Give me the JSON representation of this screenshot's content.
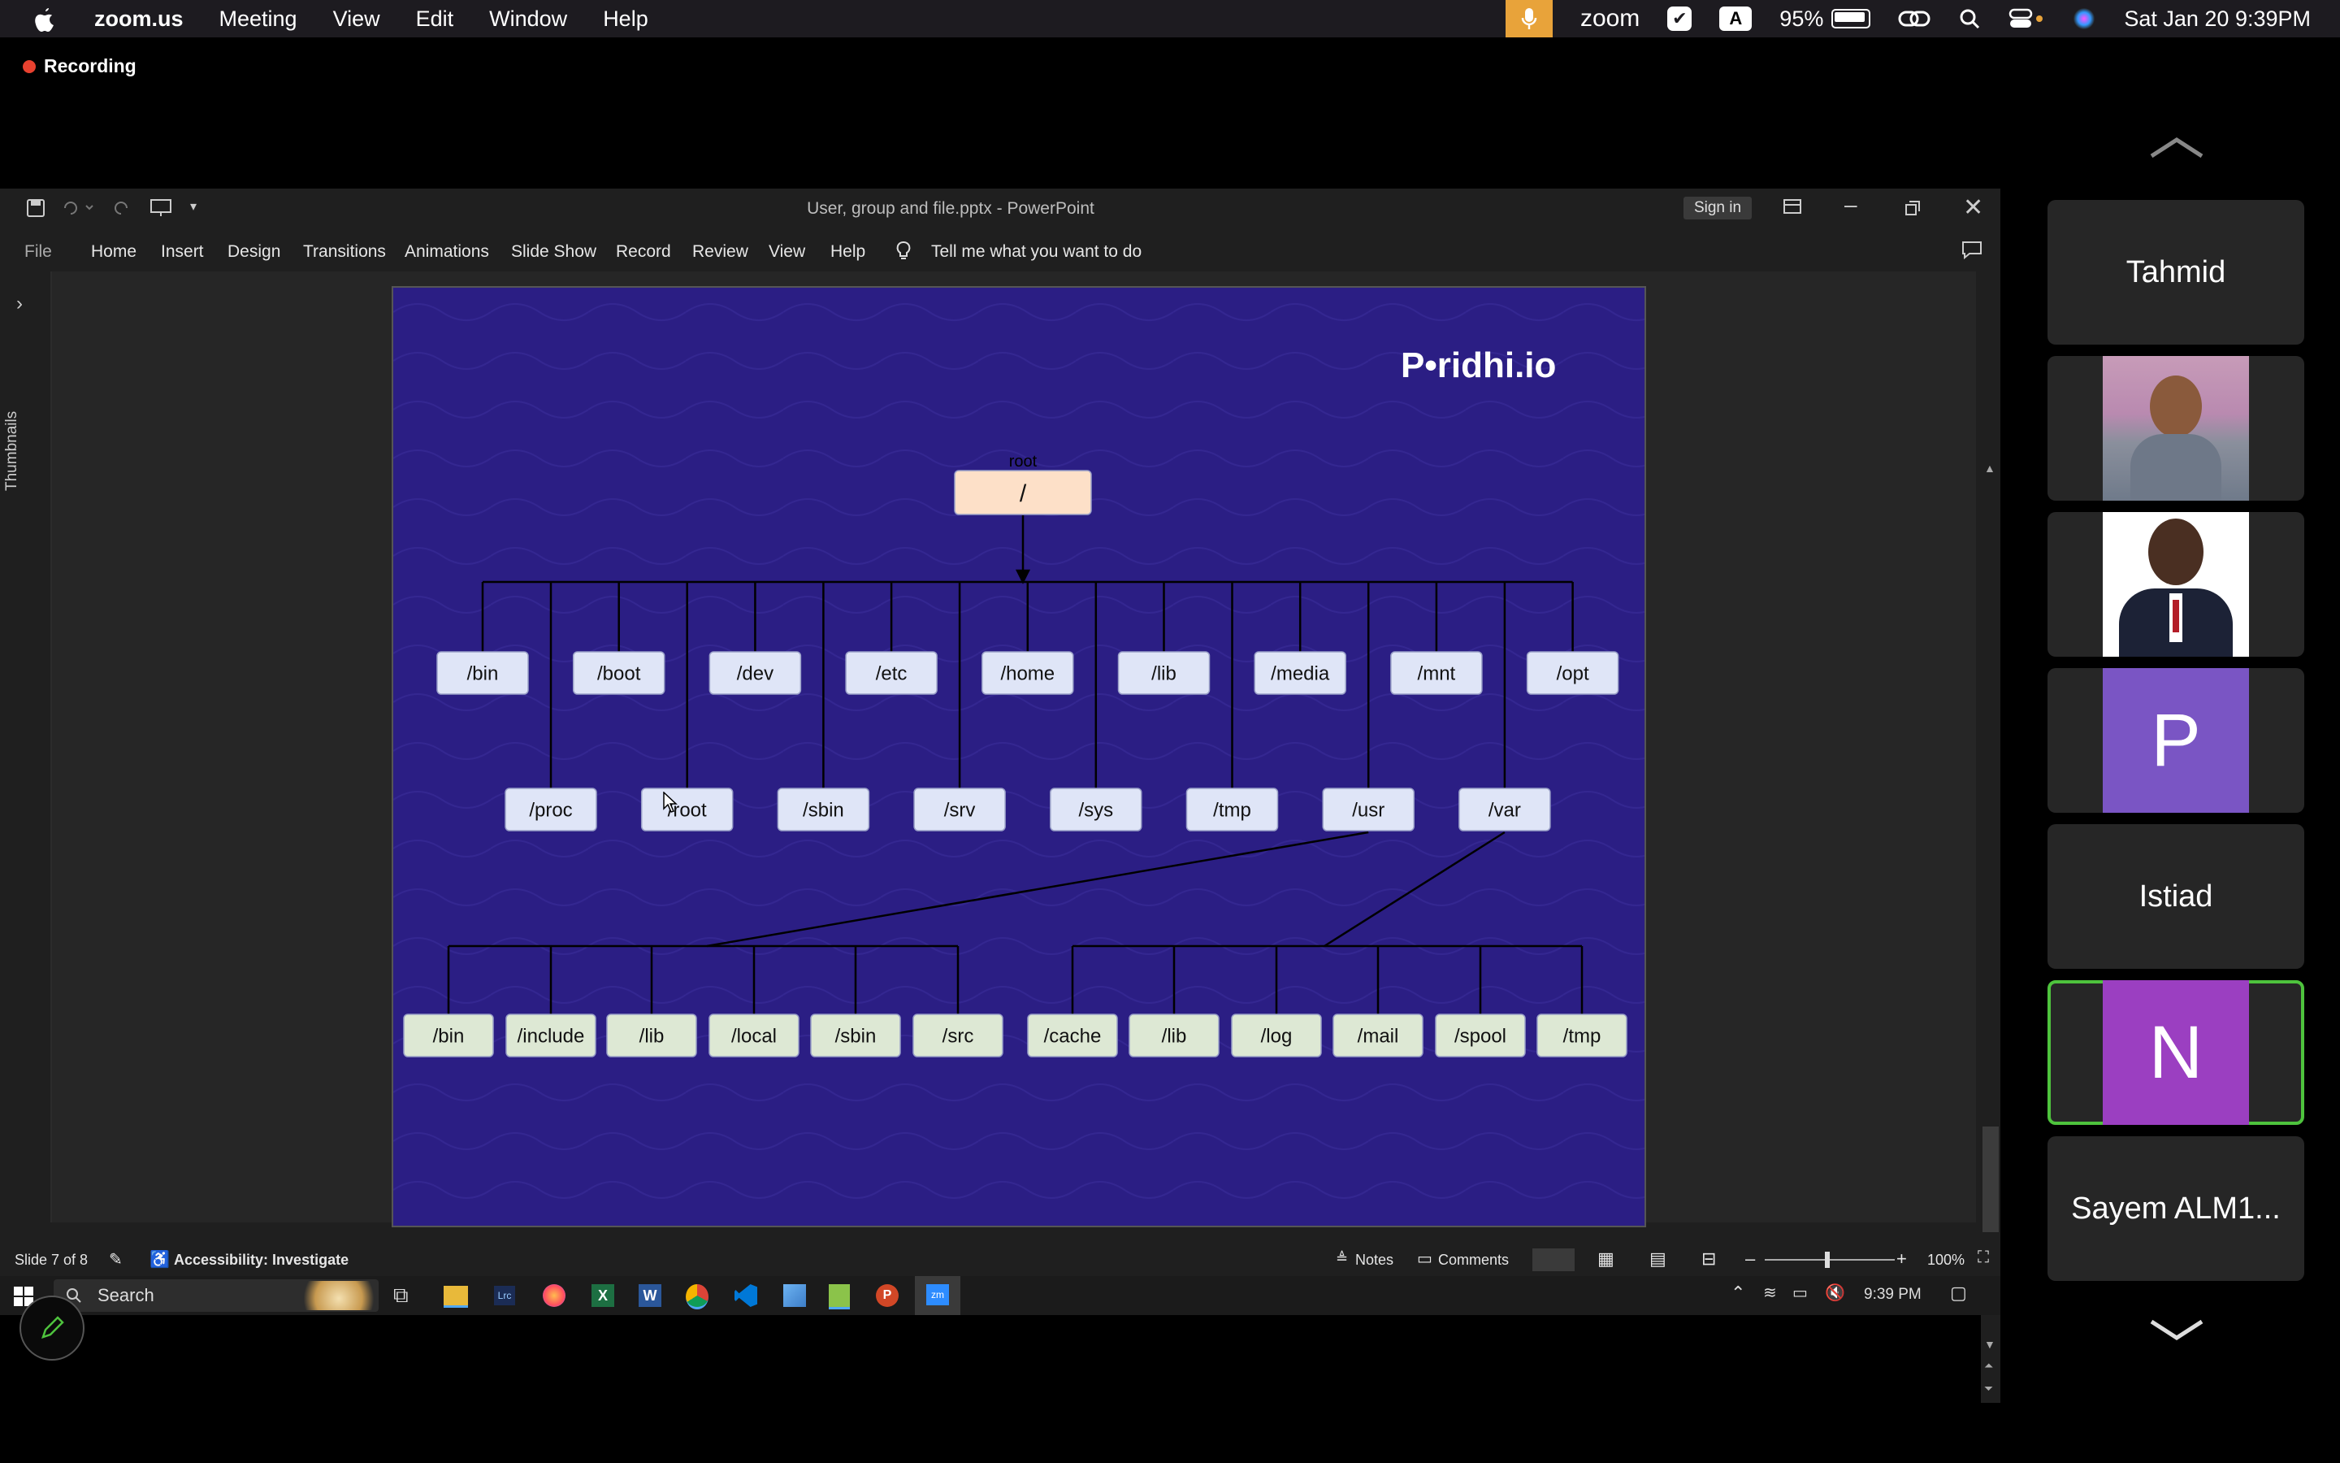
{
  "menubar": {
    "app": "zoom.us",
    "items": [
      "Meeting",
      "View",
      "Edit",
      "Window",
      "Help"
    ],
    "right": {
      "zoom_label": "zoom",
      "a_label": "A",
      "battery": "95%",
      "datetime": "Sat Jan 20  9:39PM"
    }
  },
  "recording": {
    "label": "Recording"
  },
  "ppt": {
    "window_title": "User, group and file.pptx  -  PowerPoint",
    "signin": "Sign in",
    "ribbon_tabs": [
      "File",
      "Home",
      "Insert",
      "Design",
      "Transitions",
      "Animations",
      "Slide Show",
      "Record",
      "Review",
      "View",
      "Help"
    ],
    "tell_me": "Tell me what you want to do",
    "thumbnails_label": "Thumbnails",
    "status": {
      "slide": "Slide 7 of 8",
      "accessibility": "Accessibility: Investigate",
      "notes": "Notes",
      "comments": "Comments",
      "zoom": "100%"
    }
  },
  "slide": {
    "logo": "P•ridhi.io",
    "root_caption": "root",
    "root": "/",
    "level1_row1": [
      "/bin",
      "/boot",
      "/dev",
      "/etc",
      "/home",
      "/lib",
      "/media",
      "/mnt",
      "/opt"
    ],
    "level1_row2": [
      "/proc",
      "/root",
      "/sbin",
      "/srv",
      "/sys",
      "/tmp",
      "/usr",
      "/var"
    ],
    "usr_children": [
      "/bin",
      "/include",
      "/lib",
      "/local",
      "/sbin",
      "/src"
    ],
    "var_children": [
      "/cache",
      "/lib",
      "/log",
      "/mail",
      "/spool",
      "/tmp"
    ]
  },
  "taskbar": {
    "search": "Search",
    "time": "9:39 PM"
  },
  "participants": [
    {
      "name": "Tahmid"
    },
    {
      "name": ""
    },
    {
      "name": ""
    },
    {
      "initial": "P",
      "color": "#7a55c4"
    },
    {
      "name": "Istiad"
    },
    {
      "initial": "N",
      "color": "#9b3fc1"
    },
    {
      "name": "Sayem ALM1..."
    }
  ]
}
